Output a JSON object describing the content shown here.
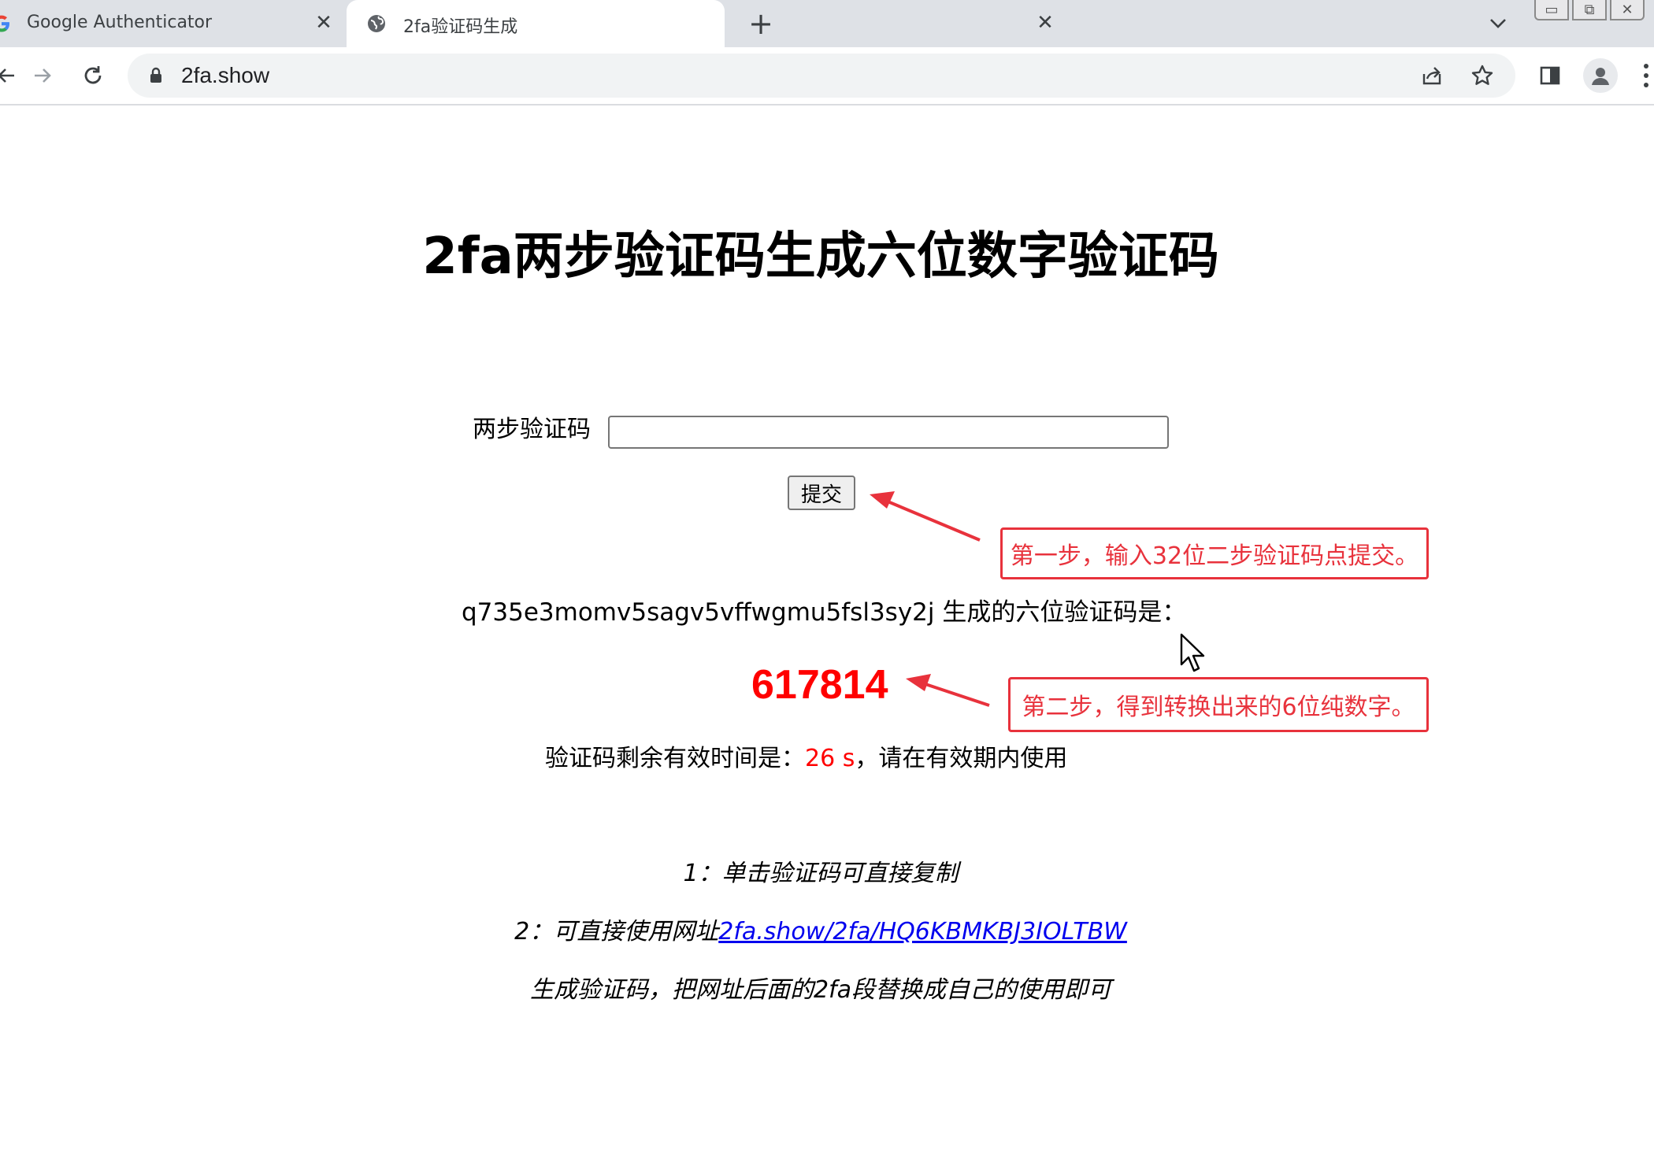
{
  "browser": {
    "tabs": [
      {
        "title": "Google Authenticator",
        "favicon": "google-icon",
        "active": false
      },
      {
        "title": "2fa验证码生成",
        "favicon": "globe-icon",
        "active": true
      }
    ],
    "url": "2fa.show"
  },
  "page": {
    "title": "2fa两步验证码生成六位数字验证码",
    "form": {
      "label": "两步验证码",
      "input_value": "",
      "submit_label": "提交"
    },
    "result": {
      "secret": "q735e3momv5sagv5vffwgmu5fsl3sy2j",
      "secret_suffix": " 生成的六位验证码是：",
      "code": "617814"
    },
    "timer": {
      "prefix": "验证码剩余有效时间是：",
      "seconds": "26 s",
      "suffix": "，请在有效期内使用"
    },
    "tips": {
      "tip1": "1：单击验证码可直接复制",
      "tip2_prefix": "2：可直接使用网址",
      "tip2_link": "2fa.show/2fa/HQ6KBMKBJ3IOLTBW",
      "tip3": "生成验证码，把网址后面的2fa段替换成自己的使用即可"
    }
  },
  "annotations": {
    "step1": "第一步，输入32位二步验证码点提交。",
    "step2": "第二步，得到转换出来的6位纯数字。"
  },
  "colors": {
    "code_red": "#ff0000",
    "annotation_red": "#e8323c",
    "link_blue": "#0000ee",
    "chrome_tabstrip": "#dee1e6"
  }
}
